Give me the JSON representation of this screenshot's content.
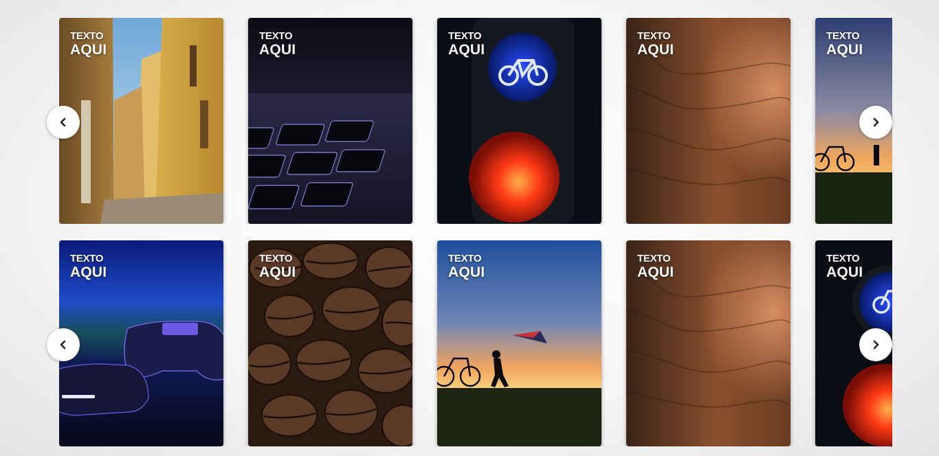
{
  "carousels": [
    {
      "cards": [
        {
          "image": "narrow-yellow-street",
          "caption_small": "TEXTO",
          "caption_big": "AQUI"
        },
        {
          "image": "keyboard-closeup",
          "caption_small": "TEXTO",
          "caption_big": "AQUI"
        },
        {
          "image": "bicycle-traffic-light",
          "caption_small": "TEXTO",
          "caption_big": "AQUI"
        },
        {
          "image": "wood-texture-light",
          "caption_small": "TEXTO",
          "caption_big": "AQUI"
        },
        {
          "image": "sunset-bike-silhouette",
          "caption_small": "TEXTO",
          "caption_big": "AQUI"
        }
      ],
      "prev_icon": "chevron-left-icon",
      "next_icon": "chevron-right-icon"
    },
    {
      "cards": [
        {
          "image": "game-controllers",
          "caption_small": "TEXTO",
          "caption_big": "AQUI"
        },
        {
          "image": "coffee-beans",
          "caption_small": "TEXTO",
          "caption_big": "AQUI"
        },
        {
          "image": "kite-sunset-child",
          "caption_small": "TEXTO",
          "caption_big": "AQUI"
        },
        {
          "image": "wood-texture-light",
          "caption_small": "TEXTO",
          "caption_big": "AQUI"
        },
        {
          "image": "bicycle-traffic-light",
          "caption_small": "TEXTO",
          "caption_big": "AQUI"
        }
      ],
      "prev_icon": "chevron-left-icon",
      "next_icon": "chevron-right-icon"
    }
  ]
}
